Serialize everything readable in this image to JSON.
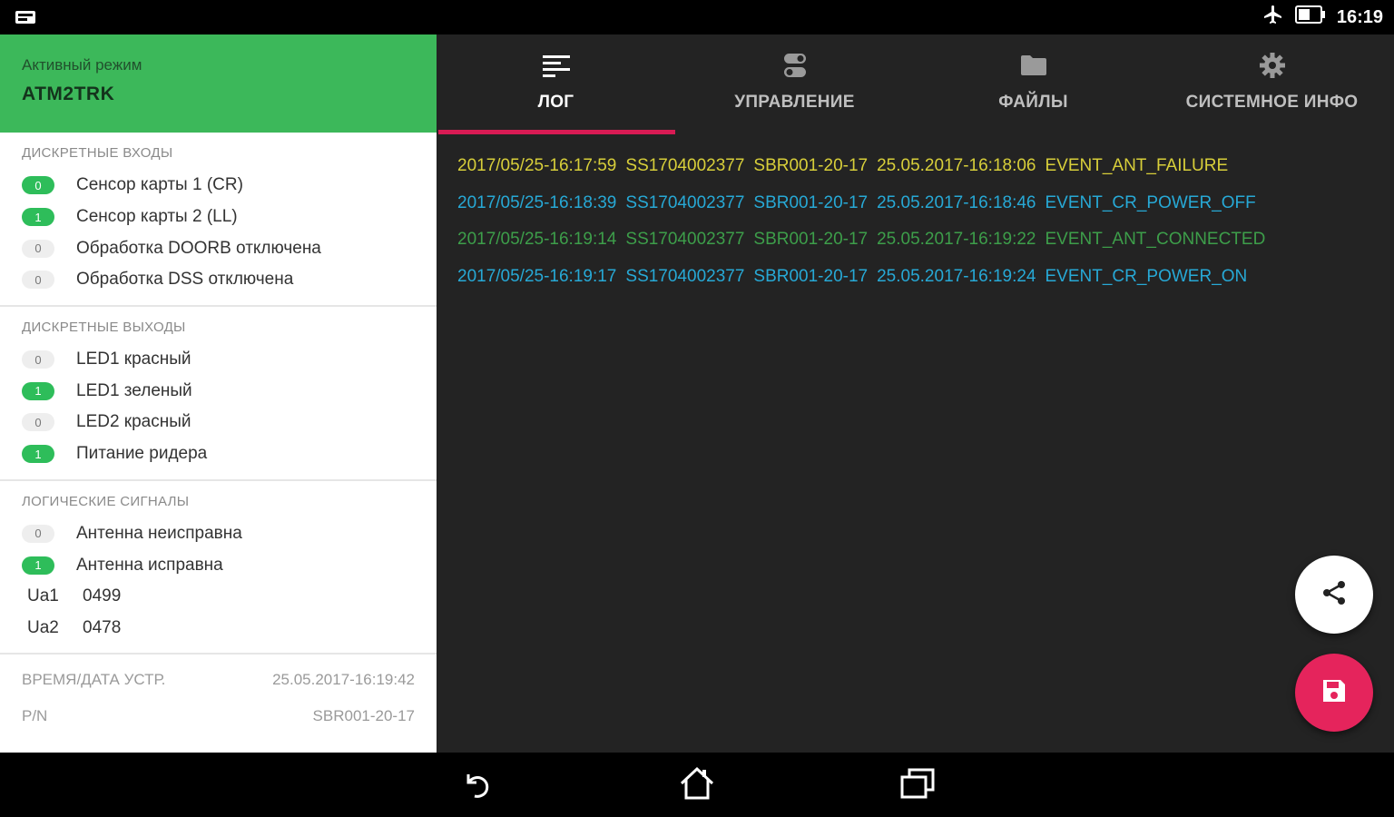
{
  "status_bar": {
    "left_icon": "notification-icon",
    "icons": [
      "airplane-mode-icon",
      "battery-icon"
    ],
    "time": "16:19"
  },
  "left_panel": {
    "mode_header": {
      "label": "Активный режим",
      "value": "ATM2TRK"
    },
    "discrete_inputs": {
      "title": "ДИСКРЕТНЫЕ ВХОДЫ",
      "items": [
        {
          "value": "0",
          "on": true,
          "label": "Сенсор карты 1 (CR)"
        },
        {
          "value": "1",
          "on": true,
          "label": "Сенсор карты 2 (LL)"
        },
        {
          "value": "0",
          "on": false,
          "label": "Обработка DOORB отключена"
        },
        {
          "value": "0",
          "on": false,
          "label": "Обработка DSS отключена"
        }
      ]
    },
    "discrete_outputs": {
      "title": "ДИСКРЕТНЫЕ ВЫХОДЫ",
      "items": [
        {
          "value": "0",
          "on": false,
          "label": "LED1 красный"
        },
        {
          "value": "1",
          "on": true,
          "label": "LED1 зеленый"
        },
        {
          "value": "0",
          "on": false,
          "label": "LED2 красный"
        },
        {
          "value": "1",
          "on": true,
          "label": "Питание ридера"
        }
      ]
    },
    "logic_signals": {
      "title": "ЛОГИЧЕСКИЕ СИГНАЛЫ",
      "items": [
        {
          "value": "0",
          "on": false,
          "label": "Антенна неисправна"
        },
        {
          "value": "1",
          "on": true,
          "label": "Антенна исправна"
        }
      ],
      "ua": [
        {
          "name": "Ua1",
          "value": "0499"
        },
        {
          "name": "Ua2",
          "value": "0478"
        }
      ]
    },
    "info": [
      {
        "label": "ВРЕМЯ/ДАТА УСТР.",
        "value": "25.05.2017-16:19:42"
      },
      {
        "label": "P/N",
        "value": "SBR001-20-17"
      }
    ]
  },
  "tabs": [
    {
      "label": "ЛОГ",
      "icon": "log-list-icon",
      "active": true
    },
    {
      "label": "УПРАВЛЕНИЕ",
      "icon": "toggle-switches-icon",
      "active": false
    },
    {
      "label": "ФАЙЛЫ",
      "icon": "folder-icon",
      "active": false
    },
    {
      "label": "СИСТЕМНОЕ ИНФО",
      "icon": "gear-icon",
      "active": false
    }
  ],
  "log": [
    {
      "color": "#d8cf3a",
      "time": "2017/05/25-16:17:59",
      "serial": "SS1704002377",
      "pn": "SBR001-20-17",
      "event_time": "25.05.2017-16:18:06",
      "event": "EVENT_ANT_FAILURE"
    },
    {
      "color": "#27a9d6",
      "time": "2017/05/25-16:18:39",
      "serial": "SS1704002377",
      "pn": "SBR001-20-17",
      "event_time": "25.05.2017-16:18:46",
      "event": "EVENT_CR_POWER_OFF"
    },
    {
      "color": "#3d9e4a",
      "time": "2017/05/25-16:19:14",
      "serial": "SS1704002377",
      "pn": "SBR001-20-17",
      "event_time": "25.05.2017-16:19:22",
      "event": "EVENT_ANT_CONNECTED"
    },
    {
      "color": "#27a9d6",
      "time": "2017/05/25-16:19:17",
      "serial": "SS1704002377",
      "pn": "SBR001-20-17",
      "event_time": "25.05.2017-16:19:24",
      "event": "EVENT_CR_POWER_ON"
    }
  ],
  "fabs": {
    "share_icon": "share-icon",
    "save_icon": "save-icon"
  },
  "nav": [
    "back-icon",
    "home-icon",
    "recents-icon"
  ],
  "colors": {
    "accent_green": "#3cb85a",
    "accent_pink": "#e5245c",
    "dark_bg": "#232323"
  }
}
